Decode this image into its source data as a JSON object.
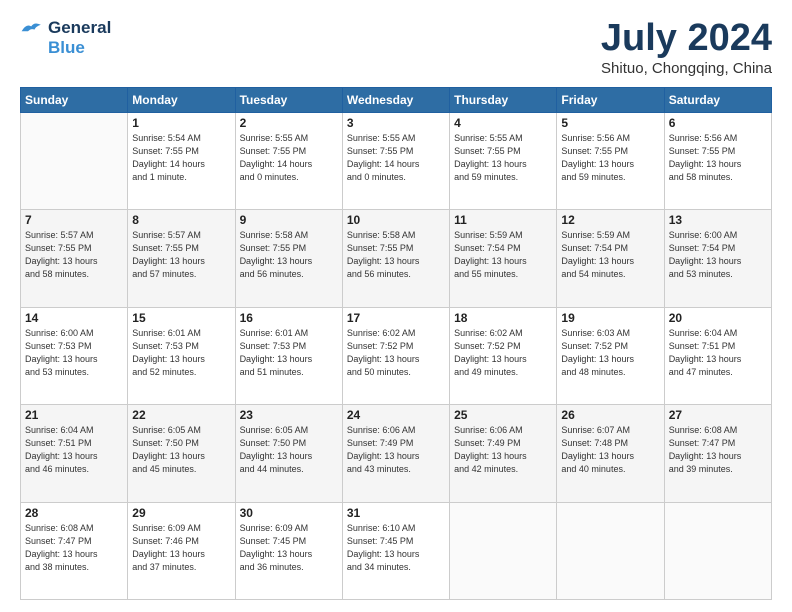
{
  "header": {
    "logo_line1": "General",
    "logo_line2": "Blue",
    "month": "July 2024",
    "location": "Shituo, Chongqing, China"
  },
  "weekdays": [
    "Sunday",
    "Monday",
    "Tuesday",
    "Wednesday",
    "Thursday",
    "Friday",
    "Saturday"
  ],
  "weeks": [
    [
      {
        "day": "",
        "info": ""
      },
      {
        "day": "1",
        "info": "Sunrise: 5:54 AM\nSunset: 7:55 PM\nDaylight: 14 hours\nand 1 minute."
      },
      {
        "day": "2",
        "info": "Sunrise: 5:55 AM\nSunset: 7:55 PM\nDaylight: 14 hours\nand 0 minutes."
      },
      {
        "day": "3",
        "info": "Sunrise: 5:55 AM\nSunset: 7:55 PM\nDaylight: 14 hours\nand 0 minutes."
      },
      {
        "day": "4",
        "info": "Sunrise: 5:55 AM\nSunset: 7:55 PM\nDaylight: 13 hours\nand 59 minutes."
      },
      {
        "day": "5",
        "info": "Sunrise: 5:56 AM\nSunset: 7:55 PM\nDaylight: 13 hours\nand 59 minutes."
      },
      {
        "day": "6",
        "info": "Sunrise: 5:56 AM\nSunset: 7:55 PM\nDaylight: 13 hours\nand 58 minutes."
      }
    ],
    [
      {
        "day": "7",
        "info": "Sunrise: 5:57 AM\nSunset: 7:55 PM\nDaylight: 13 hours\nand 58 minutes."
      },
      {
        "day": "8",
        "info": "Sunrise: 5:57 AM\nSunset: 7:55 PM\nDaylight: 13 hours\nand 57 minutes."
      },
      {
        "day": "9",
        "info": "Sunrise: 5:58 AM\nSunset: 7:55 PM\nDaylight: 13 hours\nand 56 minutes."
      },
      {
        "day": "10",
        "info": "Sunrise: 5:58 AM\nSunset: 7:55 PM\nDaylight: 13 hours\nand 56 minutes."
      },
      {
        "day": "11",
        "info": "Sunrise: 5:59 AM\nSunset: 7:54 PM\nDaylight: 13 hours\nand 55 minutes."
      },
      {
        "day": "12",
        "info": "Sunrise: 5:59 AM\nSunset: 7:54 PM\nDaylight: 13 hours\nand 54 minutes."
      },
      {
        "day": "13",
        "info": "Sunrise: 6:00 AM\nSunset: 7:54 PM\nDaylight: 13 hours\nand 53 minutes."
      }
    ],
    [
      {
        "day": "14",
        "info": "Sunrise: 6:00 AM\nSunset: 7:53 PM\nDaylight: 13 hours\nand 53 minutes."
      },
      {
        "day": "15",
        "info": "Sunrise: 6:01 AM\nSunset: 7:53 PM\nDaylight: 13 hours\nand 52 minutes."
      },
      {
        "day": "16",
        "info": "Sunrise: 6:01 AM\nSunset: 7:53 PM\nDaylight: 13 hours\nand 51 minutes."
      },
      {
        "day": "17",
        "info": "Sunrise: 6:02 AM\nSunset: 7:52 PM\nDaylight: 13 hours\nand 50 minutes."
      },
      {
        "day": "18",
        "info": "Sunrise: 6:02 AM\nSunset: 7:52 PM\nDaylight: 13 hours\nand 49 minutes."
      },
      {
        "day": "19",
        "info": "Sunrise: 6:03 AM\nSunset: 7:52 PM\nDaylight: 13 hours\nand 48 minutes."
      },
      {
        "day": "20",
        "info": "Sunrise: 6:04 AM\nSunset: 7:51 PM\nDaylight: 13 hours\nand 47 minutes."
      }
    ],
    [
      {
        "day": "21",
        "info": "Sunrise: 6:04 AM\nSunset: 7:51 PM\nDaylight: 13 hours\nand 46 minutes."
      },
      {
        "day": "22",
        "info": "Sunrise: 6:05 AM\nSunset: 7:50 PM\nDaylight: 13 hours\nand 45 minutes."
      },
      {
        "day": "23",
        "info": "Sunrise: 6:05 AM\nSunset: 7:50 PM\nDaylight: 13 hours\nand 44 minutes."
      },
      {
        "day": "24",
        "info": "Sunrise: 6:06 AM\nSunset: 7:49 PM\nDaylight: 13 hours\nand 43 minutes."
      },
      {
        "day": "25",
        "info": "Sunrise: 6:06 AM\nSunset: 7:49 PM\nDaylight: 13 hours\nand 42 minutes."
      },
      {
        "day": "26",
        "info": "Sunrise: 6:07 AM\nSunset: 7:48 PM\nDaylight: 13 hours\nand 40 minutes."
      },
      {
        "day": "27",
        "info": "Sunrise: 6:08 AM\nSunset: 7:47 PM\nDaylight: 13 hours\nand 39 minutes."
      }
    ],
    [
      {
        "day": "28",
        "info": "Sunrise: 6:08 AM\nSunset: 7:47 PM\nDaylight: 13 hours\nand 38 minutes."
      },
      {
        "day": "29",
        "info": "Sunrise: 6:09 AM\nSunset: 7:46 PM\nDaylight: 13 hours\nand 37 minutes."
      },
      {
        "day": "30",
        "info": "Sunrise: 6:09 AM\nSunset: 7:45 PM\nDaylight: 13 hours\nand 36 minutes."
      },
      {
        "day": "31",
        "info": "Sunrise: 6:10 AM\nSunset: 7:45 PM\nDaylight: 13 hours\nand 34 minutes."
      },
      {
        "day": "",
        "info": ""
      },
      {
        "day": "",
        "info": ""
      },
      {
        "day": "",
        "info": ""
      }
    ]
  ]
}
